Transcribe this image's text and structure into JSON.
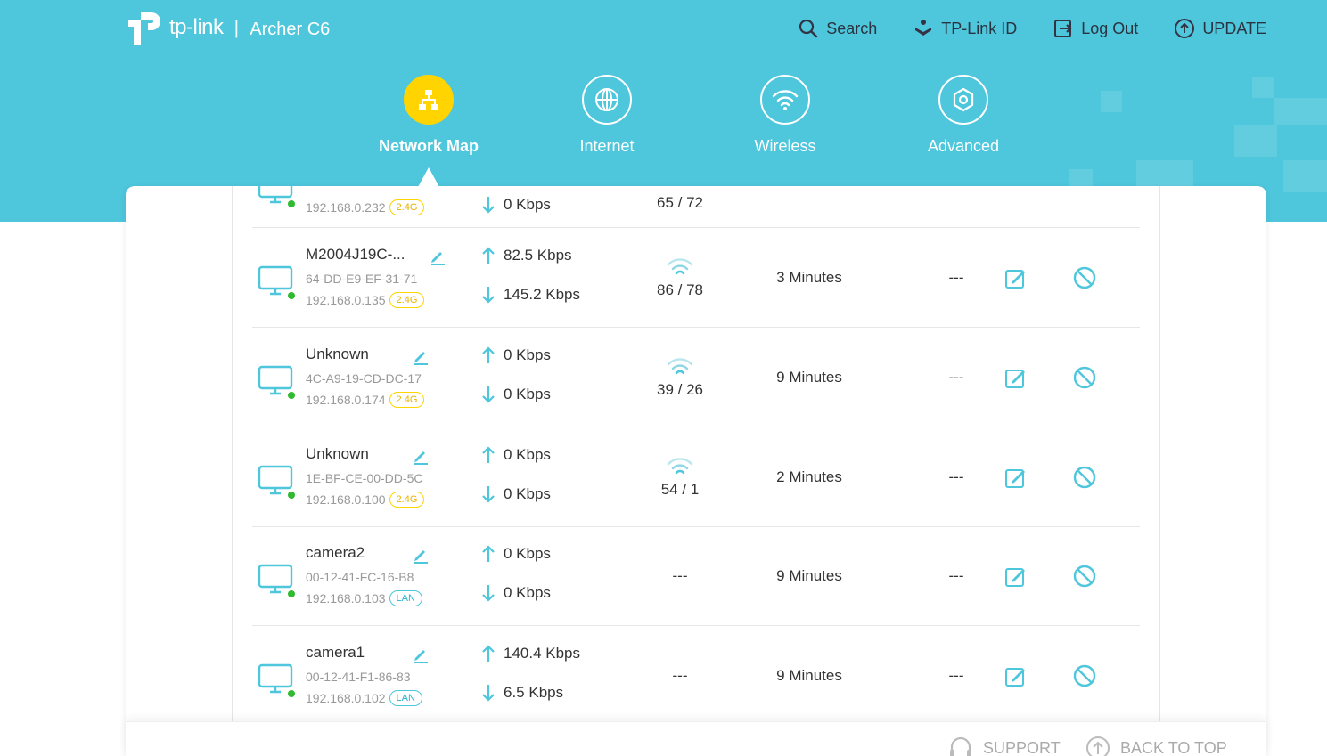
{
  "header": {
    "brand": "tp-link",
    "model": "Archer C6",
    "actions": [
      {
        "label": "Search",
        "icon": "search-icon"
      },
      {
        "label": "TP-Link ID",
        "icon": "tplink-id-icon"
      },
      {
        "label": "Log Out",
        "icon": "logout-icon"
      },
      {
        "label": "UPDATE",
        "icon": "update-icon"
      }
    ]
  },
  "nav": {
    "items": [
      {
        "label": "Network Map",
        "icon": "network-map-icon",
        "active": true
      },
      {
        "label": "Internet",
        "icon": "globe-icon",
        "active": false
      },
      {
        "label": "Wireless",
        "icon": "wifi-icon",
        "active": false
      },
      {
        "label": "Advanced",
        "icon": "gear-icon",
        "active": false
      }
    ]
  },
  "clients": {
    "partial_row": {
      "ip": "192.168.0.232",
      "band": "2.4G",
      "down": "0 Kbps",
      "signal": "65 / 72"
    },
    "rows": [
      {
        "name": "M2004J19C-...",
        "mac": "64-DD-E9-EF-31-71",
        "ip": "192.168.0.135",
        "band": "2.4G",
        "up": "82.5 Kbps",
        "down": "145.2 Kbps",
        "signal": "86 / 78",
        "duration": "3 Minutes",
        "extra": "---"
      },
      {
        "name": "Unknown",
        "mac": "4C-A9-19-CD-DC-17",
        "ip": "192.168.0.174",
        "band": "2.4G",
        "up": "0 Kbps",
        "down": "0 Kbps",
        "signal": "39 / 26",
        "duration": "9 Minutes",
        "extra": "---"
      },
      {
        "name": "Unknown",
        "mac": "1E-BF-CE-00-DD-5C",
        "ip": "192.168.0.100",
        "band": "2.4G",
        "up": "0 Kbps",
        "down": "0 Kbps",
        "signal": "54 / 1",
        "duration": "2 Minutes",
        "extra": "---"
      },
      {
        "name": "camera2",
        "mac": "00-12-41-FC-16-B8",
        "ip": "192.168.0.103",
        "band": "LAN",
        "up": "0 Kbps",
        "down": "0 Kbps",
        "signal": "---",
        "duration": "9 Minutes",
        "extra": "---"
      },
      {
        "name": "camera1",
        "mac": "00-12-41-F1-86-83",
        "ip": "192.168.0.102",
        "band": "LAN",
        "up": "140.4 Kbps",
        "down": "6.5 Kbps",
        "signal": "---",
        "duration": "9 Minutes",
        "extra": "---"
      }
    ]
  },
  "footer": {
    "support": "SUPPORT",
    "back_to_top": "BACK TO TOP"
  },
  "colors": {
    "banner": "#4ec6dc",
    "accent": "#4ec6dc",
    "active_nav": "#ffd400",
    "online_dot": "#2fba2f"
  }
}
